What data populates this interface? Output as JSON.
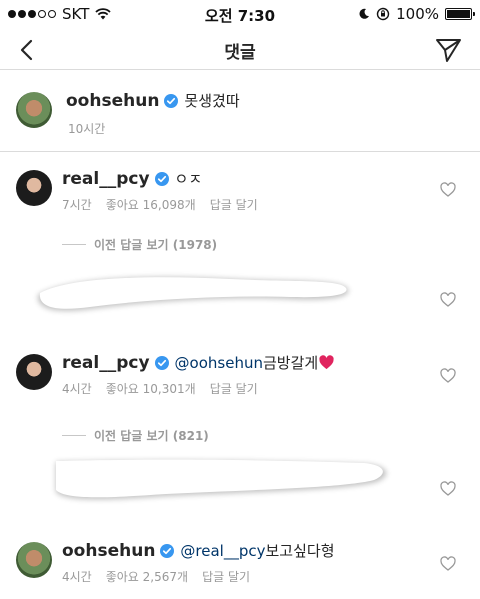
{
  "status_bar": {
    "carrier": "SKT",
    "time": "오전 7:30",
    "battery": "100%"
  },
  "nav": {
    "title": "댓글",
    "back_icon": "chevron-left-icon",
    "send_icon": "paper-plane-icon"
  },
  "caption": {
    "username": "oohsehun",
    "text": "못생겼따",
    "time": "10시간"
  },
  "comments": [
    {
      "username": "real__pcy",
      "text": "ㅇㅈ",
      "time": "7시간",
      "likes": "좋아요 16,098개",
      "reply": "답글 달기",
      "view_replies": "이전 답글 보기 (1978)"
    },
    {
      "username": "real__pcy",
      "mention": "@oohsehun",
      "text": " 금방갈게",
      "time": "4시간",
      "likes": "좋아요 10,301개",
      "reply": "답글 달기",
      "view_replies": "이전 답글 보기 (821)"
    },
    {
      "username": "oohsehun",
      "mention": "@real__pcy",
      "text": "보고싶다형",
      "time": "4시간",
      "likes": "좋아요 2,567개",
      "reply": "답글 달기"
    }
  ],
  "colors": {
    "verified_blue": "#3897f0",
    "mention": "#003569",
    "meta_gray": "#999999",
    "divider": "#dbdbdb",
    "heart_red": "#e0245e"
  }
}
